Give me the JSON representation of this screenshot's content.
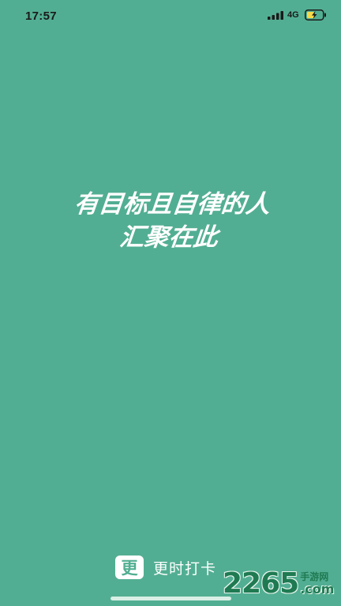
{
  "status_bar": {
    "time": "17:57",
    "network": "4G",
    "signal_icon": "signal-bars-icon",
    "battery_icon": "battery-charging-icon"
  },
  "splash": {
    "line1": "有目标且自律的人",
    "line2": "汇聚在此"
  },
  "brand": {
    "logo_char": "更",
    "name": "更时打卡"
  },
  "watermark": {
    "number": "2265",
    "cn": "手游网",
    "com": ".com"
  },
  "colors": {
    "background": "#52ae92",
    "text": "#ffffff",
    "watermark": "#1f7a52"
  }
}
